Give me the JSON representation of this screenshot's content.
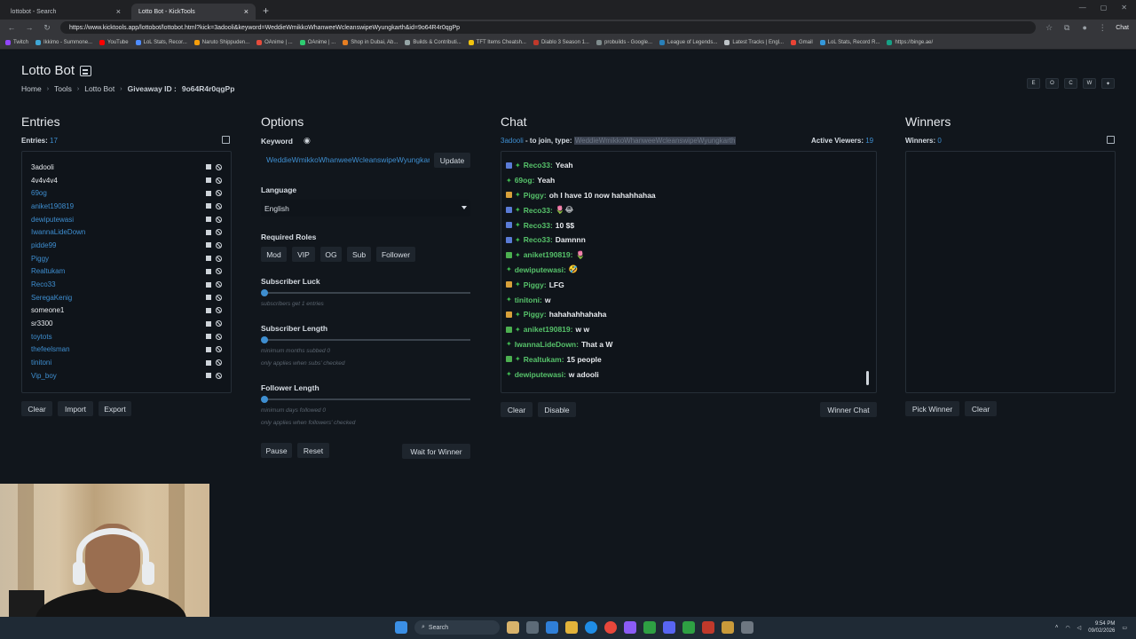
{
  "browser": {
    "tabs": [
      {
        "title": "lottobot - Search",
        "active": false
      },
      {
        "title": "Lotto Bot - KickTools",
        "active": true
      }
    ],
    "url": "https://www.kicktools.app/lottobot/lottobot.html?kick=3adooli&keyword=WeddieWmikkoWhanweeWcleanswipeWyungkarth&id=9o64R4r0qgPp",
    "chat_button": "Chat",
    "bookmarks": [
      "Twitch",
      "Ikkimo - Summone...",
      "YouTube",
      "LoL Stats, Recor...",
      "Naruto Shippuden...",
      "OAnime | ...",
      "OAnime | ...",
      "Shop in Dubai, Ab...",
      "Builds & Contributi...",
      "TFT Items Cheatsh...",
      "Diablo 3 Season 1...",
      "probuilds - Google...",
      "League of Legends...",
      "Latest Tracks | Engl...",
      "Gmail",
      "LoL Stats, Record R...",
      "https://binge.ae/"
    ]
  },
  "app": {
    "title": "Lotto Bot",
    "breadcrumb": [
      "Home",
      "Tools",
      "Lotto Bot",
      "Giveaway ID :",
      "9o64R4r0qgPp"
    ],
    "top_icons": [
      "E",
      "O",
      "C",
      "W",
      "✦"
    ]
  },
  "entries": {
    "title": "Entries",
    "count_label": "Entries:",
    "count": "17",
    "items": [
      {
        "name": "3adooli",
        "color": "white"
      },
      {
        "name": "4v4v4v4",
        "color": "white"
      },
      {
        "name": "69og",
        "color": "blue"
      },
      {
        "name": "aniket190819",
        "color": "blue"
      },
      {
        "name": "dewiputewasi",
        "color": "blue"
      },
      {
        "name": "IwannaLideDown",
        "color": "blue"
      },
      {
        "name": "pidde99",
        "color": "blue"
      },
      {
        "name": "Piggy",
        "color": "blue"
      },
      {
        "name": "Realtukam",
        "color": "blue"
      },
      {
        "name": "Reco33",
        "color": "blue"
      },
      {
        "name": "SeregaKenig",
        "color": "blue"
      },
      {
        "name": "someone1",
        "color": "white"
      },
      {
        "name": "sr3300",
        "color": "white"
      },
      {
        "name": "toytots",
        "color": "blue"
      },
      {
        "name": "thefeelsman",
        "color": "blue"
      },
      {
        "name": "tinitoni",
        "color": "blue"
      },
      {
        "name": "Vip_boy",
        "color": "blue"
      }
    ],
    "buttons": {
      "clear": "Clear",
      "import": "Import",
      "export": "Export"
    }
  },
  "options": {
    "title": "Options",
    "keyword_label": "Keyword",
    "keyword_value": "WeddieWmikkoWhanweeWcleanswipeWyungkarth",
    "update_button": "Update",
    "language_label": "Language",
    "language_value": "English",
    "required_roles_label": "Required Roles",
    "roles": [
      "Mod",
      "VIP",
      "OG",
      "Sub",
      "Follower"
    ],
    "subscriber_luck_label": "Subscriber Luck",
    "subscriber_luck_hint": "subscribers get 1 entries",
    "subscriber_length_label": "Subscriber Length",
    "subscriber_length_hint1": "minimum months subbed 0",
    "subscriber_length_hint2": "only applies when subs' checked",
    "follower_length_label": "Follower Length",
    "follower_length_hint1": "minimum days followed 0",
    "follower_length_hint2": "only applies when followers' checked",
    "pause_button": "Pause",
    "reset_button": "Reset",
    "wait_button": "Wait for Winner"
  },
  "chat": {
    "title": "Chat",
    "join_user": "3adooli",
    "join_text": "- to join, type:",
    "join_keyword": "WeddieWmikkoWhanweeWcleanswipeWyungkarth",
    "active_viewers_label": "Active Viewers:",
    "active_viewers": "19",
    "messages": [
      {
        "badge": "#5a7bd6",
        "user": "Reco33:",
        "text": "Yeah"
      },
      {
        "badge": "",
        "user": "69og:",
        "text": "Yeah"
      },
      {
        "badge": "#d8a03a",
        "user": "Piggy:",
        "text": "oh I have 10 now hahahhahaa"
      },
      {
        "badge": "#5a7bd6",
        "user": "Reco33:",
        "text": "🌷😂"
      },
      {
        "badge": "#5a7bd6",
        "user": "Reco33:",
        "text": "10 $$"
      },
      {
        "badge": "#5a7bd6",
        "user": "Reco33:",
        "text": "Damnnn"
      },
      {
        "badge": "#4caf50",
        "user": "aniket190819:",
        "text": "🌷"
      },
      {
        "badge": "",
        "user": "dewiputewasi:",
        "text": "🤣"
      },
      {
        "badge": "#d8a03a",
        "user": "Piggy:",
        "text": "LFG"
      },
      {
        "badge": "",
        "user": "tinitoni:",
        "text": "w"
      },
      {
        "badge": "#d8a03a",
        "user": "Piggy:",
        "text": "hahahahhahaha"
      },
      {
        "badge": "#4caf50",
        "user": "aniket190819:",
        "text": "w w"
      },
      {
        "badge": "",
        "user": "IwannaLideDown:",
        "text": "That a W"
      },
      {
        "badge": "#4caf50",
        "user": "Realtukam:",
        "text": "15 people"
      },
      {
        "badge": "",
        "user": "dewiputewasi:",
        "text": "w adooli"
      }
    ],
    "buttons": {
      "clear": "Clear",
      "disable": "Disable",
      "winner_chat": "Winner Chat"
    }
  },
  "winners": {
    "title": "Winners",
    "count_label": "Winners:",
    "count": "0",
    "buttons": {
      "pick": "Pick Winner",
      "clear": "Clear"
    }
  },
  "taskbar": {
    "search_label": "Search",
    "time": "9:54 PM",
    "date": "09/02/2026"
  }
}
